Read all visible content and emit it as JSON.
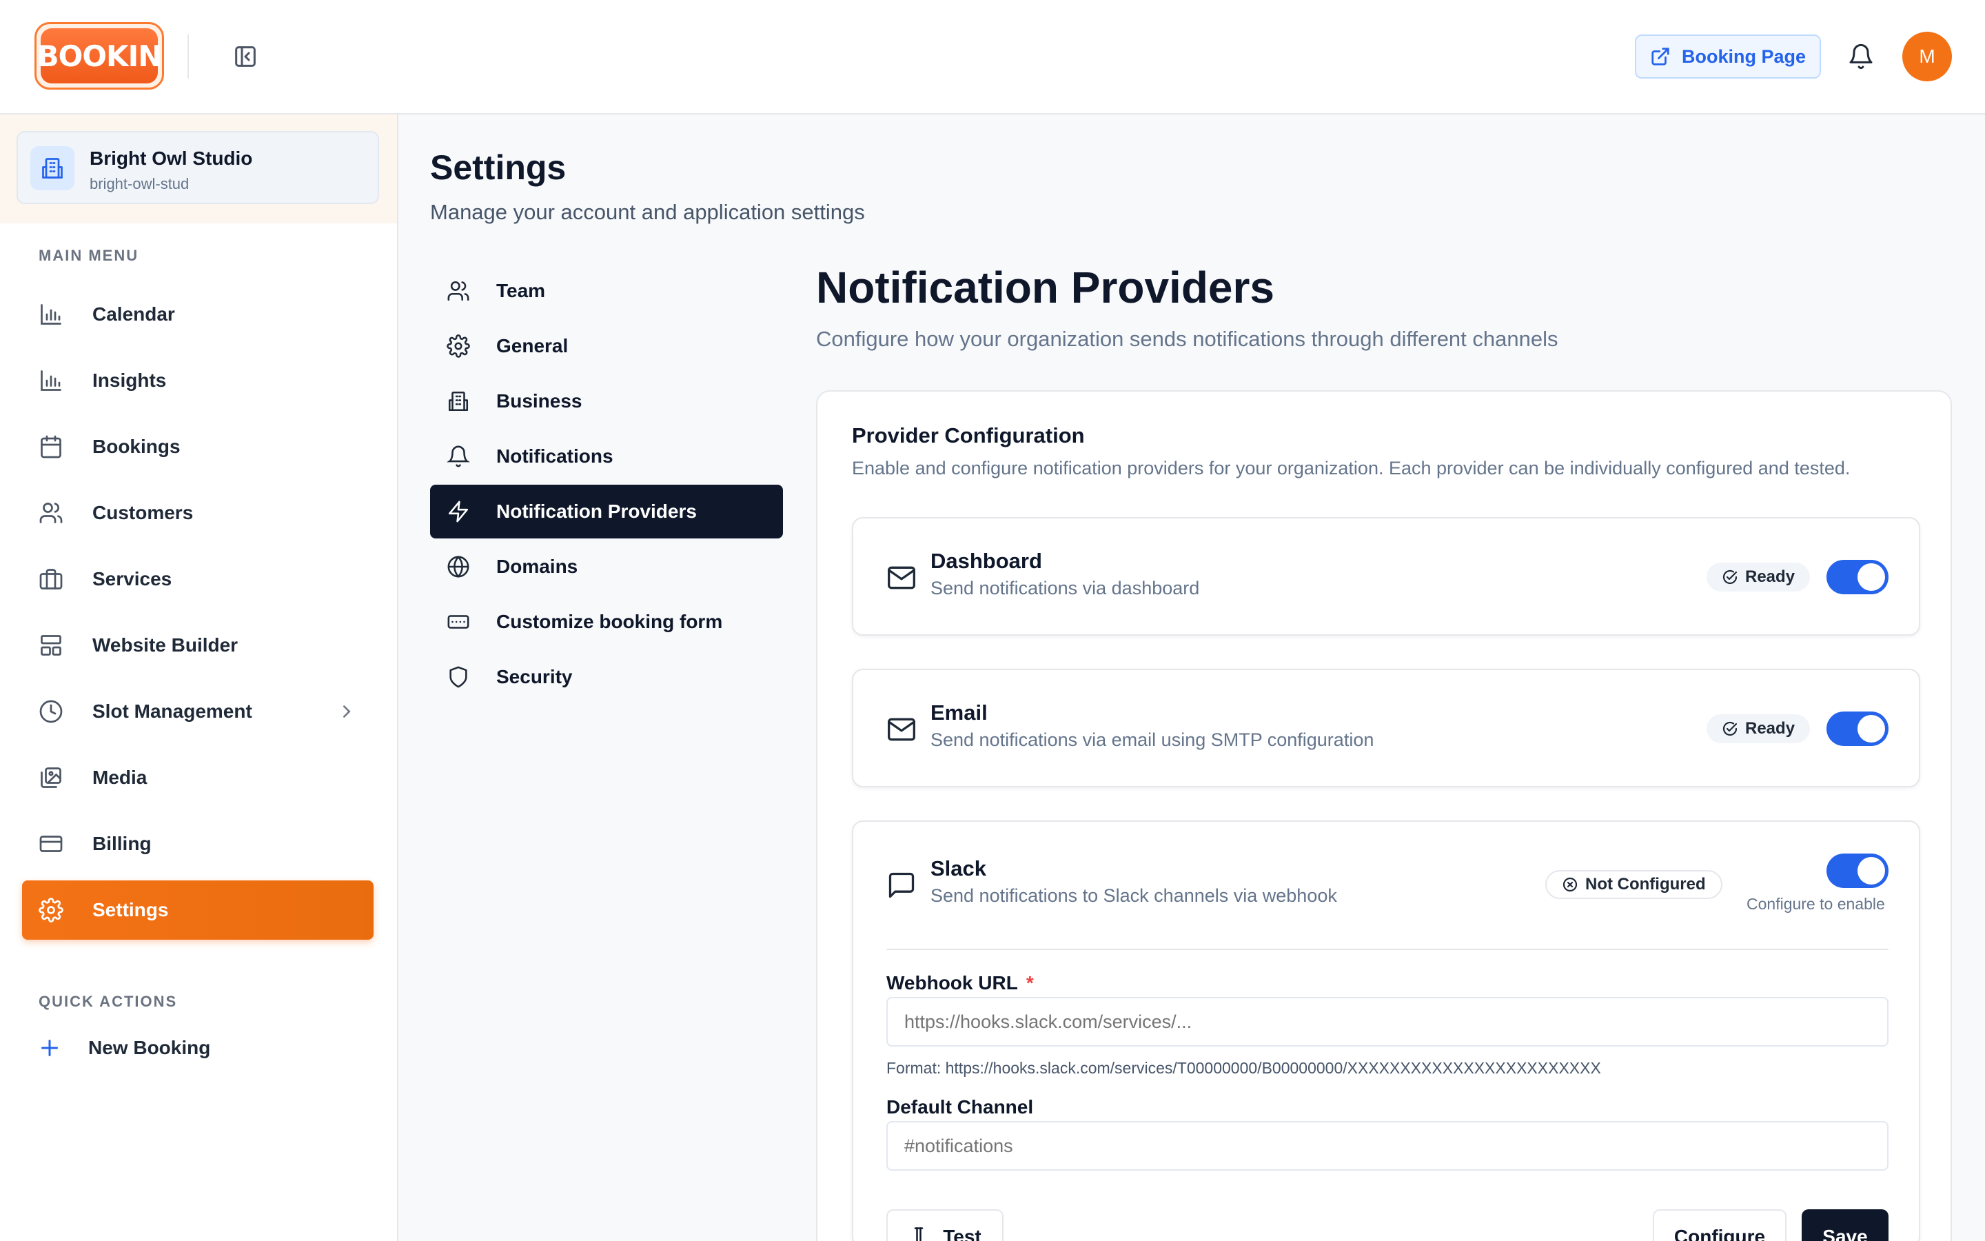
{
  "header": {
    "logo_text": "BOOKIN",
    "booking_page_label": "Booking Page",
    "avatar_initial": "M"
  },
  "org": {
    "name": "Bright Owl Studio",
    "slug": "bright-owl-stud"
  },
  "sidebar": {
    "main_menu_label": "MAIN MENU",
    "items": [
      {
        "label": "Calendar",
        "icon": "bar-chart-icon"
      },
      {
        "label": "Insights",
        "icon": "bar-chart-icon"
      },
      {
        "label": "Bookings",
        "icon": "calendar-icon"
      },
      {
        "label": "Customers",
        "icon": "users-icon"
      },
      {
        "label": "Services",
        "icon": "briefcase-icon"
      },
      {
        "label": "Website Builder",
        "icon": "layout-icon"
      },
      {
        "label": "Slot Management",
        "icon": "clock-icon"
      },
      {
        "label": "Media",
        "icon": "images-icon"
      },
      {
        "label": "Billing",
        "icon": "credit-card-icon"
      },
      {
        "label": "Settings",
        "icon": "gear-icon",
        "active": true
      }
    ],
    "quick_actions_label": "QUICK ACTIONS",
    "quick_action": "New Booking"
  },
  "page": {
    "title": "Settings",
    "subtitle": "Manage your account and application settings"
  },
  "settings_nav": [
    {
      "label": "Team",
      "icon": "users-icon"
    },
    {
      "label": "General",
      "icon": "gear-icon"
    },
    {
      "label": "Business",
      "icon": "building-icon"
    },
    {
      "label": "Notifications",
      "icon": "bell-icon"
    },
    {
      "label": "Notification Providers",
      "icon": "lightning-icon",
      "active": true
    },
    {
      "label": "Domains",
      "icon": "globe-icon"
    },
    {
      "label": "Customize booking form",
      "icon": "form-icon"
    },
    {
      "label": "Security",
      "icon": "shield-icon"
    }
  ],
  "providers_section": {
    "title": "Notification Providers",
    "subtitle": "Configure how your organization sends notifications through different channels",
    "card_title": "Provider Configuration",
    "card_subtitle": "Enable and configure notification providers for your organization. Each provider can be individually configured and tested."
  },
  "providers": [
    {
      "name": "Dashboard",
      "description": "Send notifications via dashboard",
      "status": "Ready",
      "enabled": true
    },
    {
      "name": "Email",
      "description": "Send notifications via email using SMTP configuration",
      "status": "Ready",
      "enabled": true
    },
    {
      "name": "Slack",
      "description": "Send notifications to Slack channels via webhook",
      "status": "Not Configured",
      "enabled": true,
      "helper": "Configure to enable"
    }
  ],
  "slack_form": {
    "webhook_label": "Webhook URL",
    "required_mark": "*",
    "webhook_placeholder": "https://hooks.slack.com/services/...",
    "format_hint": "Format: https://hooks.slack.com/services/T00000000/B00000000/XXXXXXXXXXXXXXXXXXXXXXXX",
    "channel_label": "Default Channel",
    "channel_placeholder": "#notifications",
    "test_label": "Test",
    "configure_label": "Configure",
    "save_label": "Save"
  },
  "colors": {
    "accent_orange": "#f47216",
    "primary_blue": "#2563eb",
    "dark": "#0f172a"
  }
}
